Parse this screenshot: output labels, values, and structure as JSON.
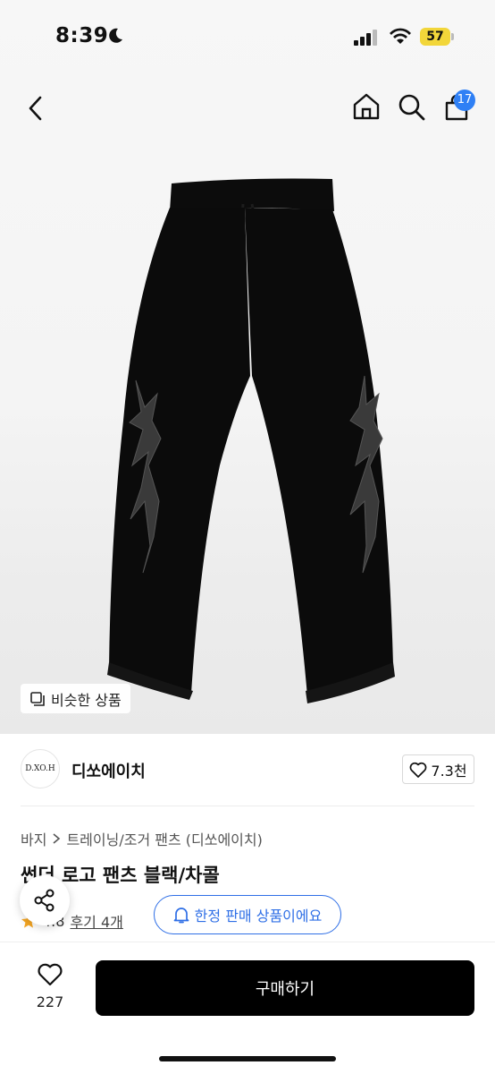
{
  "status_bar": {
    "time": "8:39",
    "battery_level": "57"
  },
  "nav": {
    "cart_count": "17"
  },
  "hero": {
    "similar_products_label": "비슷한 상품"
  },
  "brand": {
    "logo_text": "D.XO.H",
    "name": "디쏘에이치",
    "like_count": "7.3천"
  },
  "breadcrumb": {
    "items": [
      "바지",
      "트레이닝/조거 팬츠 (디쏘에이치)"
    ]
  },
  "product": {
    "title": "썬더 로고 팬츠 블랙/차콜",
    "rating": "4.8",
    "reviews_label": "후기 4개",
    "limited_label": "한정 판매 상품이에요"
  },
  "bottom_bar": {
    "wish_count": "227",
    "buy_label": "구매하기"
  },
  "colors": {
    "accent_blue": "#2f6fe6",
    "badge_blue": "#2f80f5",
    "buy_button": "#000000",
    "battery": "#f2d63a"
  }
}
